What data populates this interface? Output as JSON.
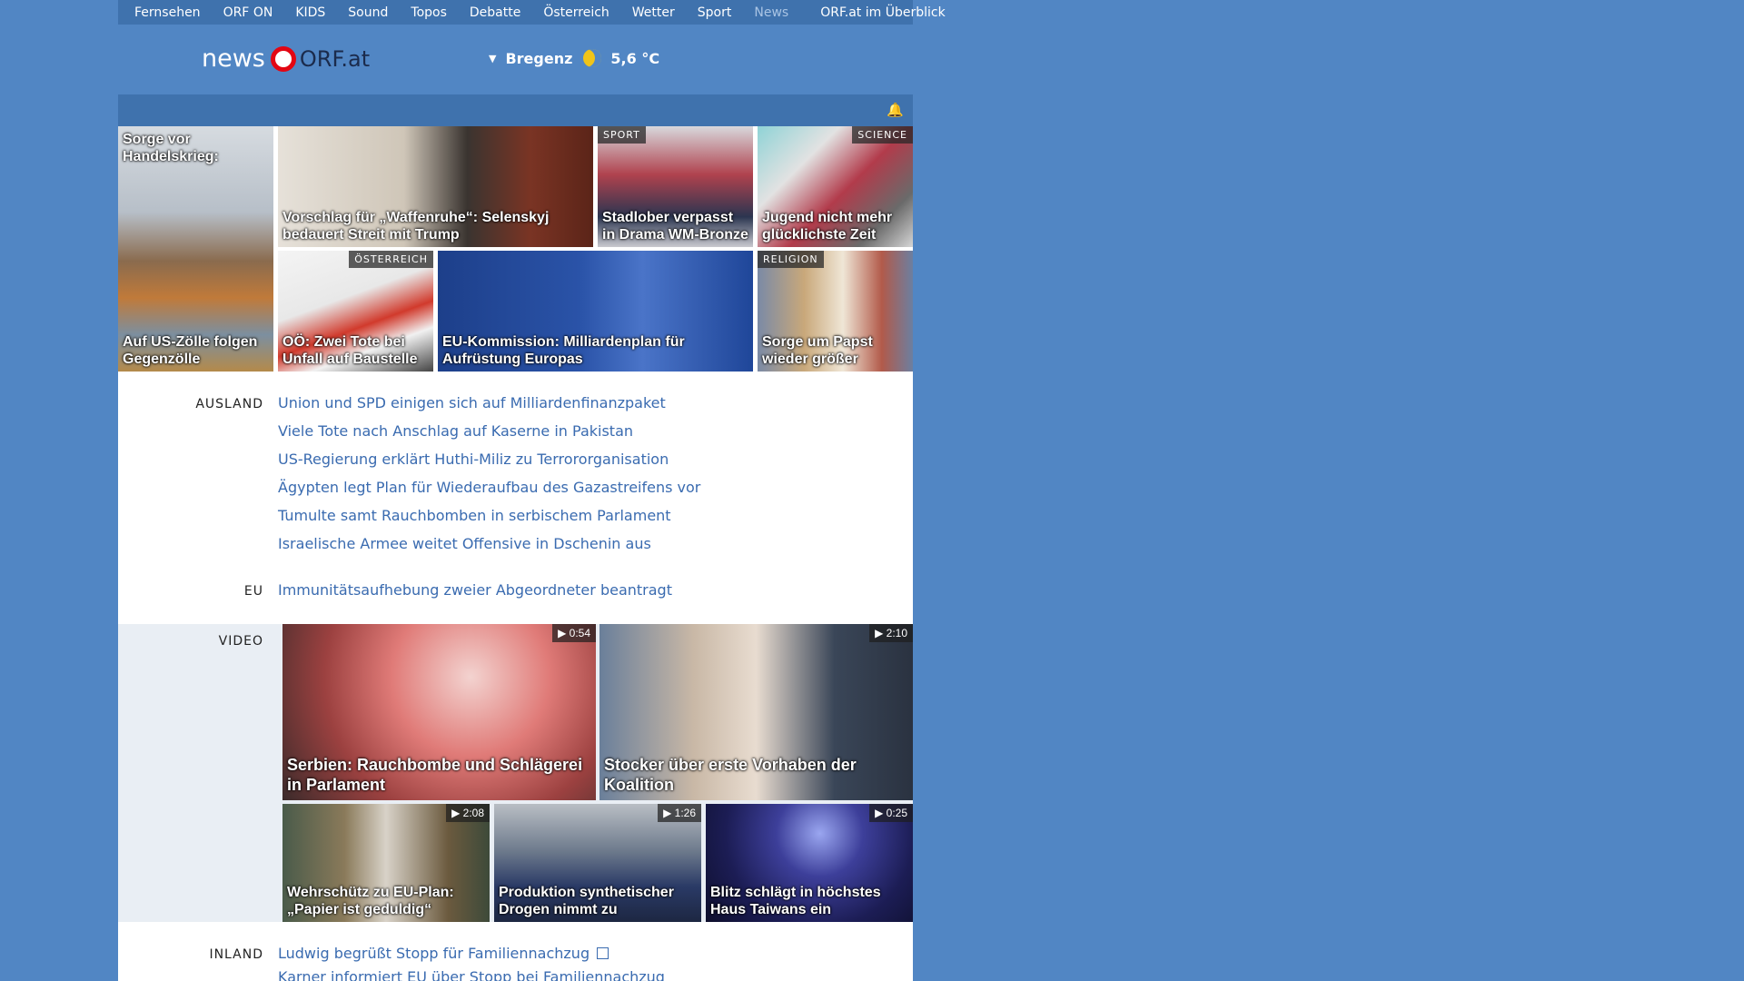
{
  "top_nav": [
    "Fernsehen",
    "ORF ON",
    "KIDS",
    "Sound",
    "Topos",
    "Debatte",
    "Österreich",
    "Wetter",
    "Sport",
    "News",
    "ORF.at im Überblick"
  ],
  "logo": {
    "news": "news",
    "orf": "ORF.at"
  },
  "weather": {
    "location": "Bregenz",
    "temperature": "5,6 °C",
    "icon": "moon-icon"
  },
  "tiles": [
    {
      "caption_top": "Sorge vor Handelskrieg:",
      "caption": "Auf US-Zölle folgen Gegenzölle",
      "tag": ""
    },
    {
      "caption": "Vorschlag für „Waffenruhe“: Selenskyj bedauert Streit mit Trump",
      "tag": ""
    },
    {
      "caption": "Stadlober verpasst in Drama WM-Bronze",
      "tag": "SPORT"
    },
    {
      "caption": "Jugend nicht mehr glücklichste Zeit",
      "tag": "SCIENCE"
    },
    {
      "caption": "OÖ: Zwei Tote bei Unfall auf Baustelle",
      "tag": "ÖSTERREICH"
    },
    {
      "caption": "EU-Kommission: Milliardenplan für Aufrüstung Europas",
      "tag": ""
    },
    {
      "caption": "Sorge um Papst wieder größer",
      "tag": "RELIGION"
    }
  ],
  "ausland": {
    "label": "AUSLAND",
    "links": [
      "Union und SPD einigen sich auf Milliardenfinanzpaket",
      "Viele Tote nach Anschlag auf Kaserne in Pakistan",
      "US-Regierung erklärt Huthi-Miliz zu Terrororganisation",
      "Ägypten legt Plan für Wiederaufbau des Gazastreifens vor",
      "Tumulte samt Rauchbomben in serbischem Parlament",
      "Israelische Armee weitet Offensive in Dschenin aus"
    ]
  },
  "eu": {
    "label": "EU",
    "links": [
      "Immunitätsaufhebung zweier Abgeordneter beantragt"
    ]
  },
  "video": {
    "label": "VIDEO",
    "items": [
      {
        "caption": "Serbien: Rauchbombe und Schlägerei in Parlament",
        "duration": "▶ 0:54"
      },
      {
        "caption": "Stocker über erste Vorhaben der Koalition",
        "duration": "▶ 2:10"
      },
      {
        "caption": "Wehrschütz zu EU-Plan: „Papier ist geduldig“",
        "duration": "▶ 2:08"
      },
      {
        "caption": "Produktion synthetischer Drogen nimmt zu",
        "duration": "▶ 1:26"
      },
      {
        "caption": "Blitz schlägt in höchstes Haus Taiwans ein",
        "duration": "▶ 0:25"
      }
    ]
  },
  "inland": {
    "label": "INLAND",
    "links": [
      "Ludwig begrüßt Stopp für Familiennachzug",
      "Karner informiert EU über Stopp bei Familiennachzug"
    ]
  },
  "colors": {
    "page_bg": "#5186c4",
    "nav_bg": "#3f72ad",
    "link": "#3a6bb0",
    "orf_red": "#e30613"
  }
}
